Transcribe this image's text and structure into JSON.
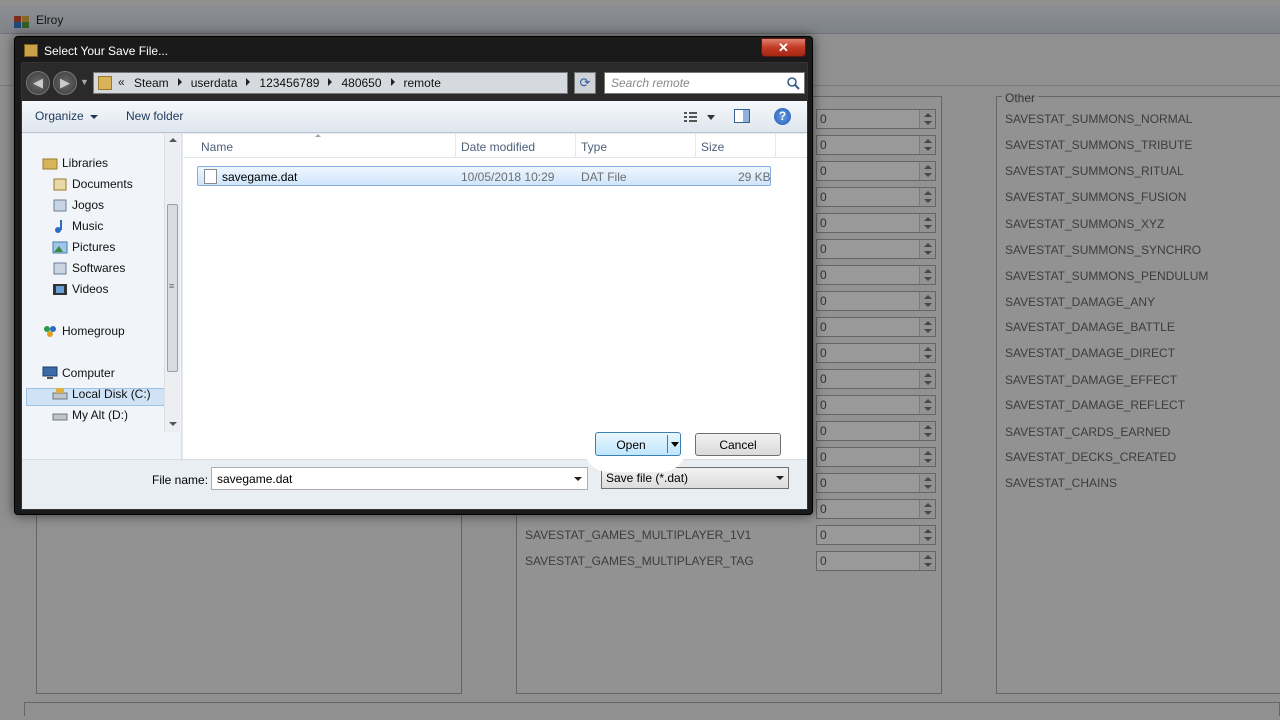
{
  "app": {
    "title": "Elroy",
    "panel_other_title": "Other",
    "other_stats": [
      "SAVESTAT_SUMMONS_NORMAL",
      "SAVESTAT_SUMMONS_TRIBUTE",
      "SAVESTAT_SUMMONS_RITUAL",
      "SAVESTAT_SUMMONS_FUSION",
      "SAVESTAT_SUMMONS_XYZ",
      "SAVESTAT_SUMMONS_SYNCHRO",
      "SAVESTAT_SUMMONS_PENDULUM",
      "SAVESTAT_DAMAGE_ANY",
      "SAVESTAT_DAMAGE_BATTLE",
      "SAVESTAT_DAMAGE_DIRECT",
      "SAVESTAT_DAMAGE_EFFECT",
      "SAVESTAT_DAMAGE_REFLECT",
      "SAVESTAT_CARDS_EARNED",
      "SAVESTAT_DECKS_CREATED",
      "SAVESTAT_CHAINS"
    ],
    "mid_stats": [
      "SAVESTAT_GAMES_MULTIPLAYER_1V1",
      "SAVESTAT_GAMES_MULTIPLAYER_TAG"
    ],
    "spinner_value": "0"
  },
  "dialog": {
    "title": "Select Your Save File...",
    "close_label": "✕",
    "breadcrumbs": [
      "Steam",
      "userdata",
      "123456789",
      "480650",
      "remote"
    ],
    "breadcrumb_overflow": "«",
    "search_placeholder": "Search remote",
    "toolbar": {
      "organize": "Organize",
      "new_folder": "New folder",
      "help": "?"
    },
    "nav": {
      "libraries": "Libraries",
      "library_items": [
        "Documents",
        "Jogos",
        "Music",
        "Pictures",
        "Softwares",
        "Videos"
      ],
      "homegroup": "Homegroup",
      "computer": "Computer",
      "drives": [
        "Local Disk (C:)",
        "My Alt (D:)"
      ],
      "scroll_grip": "≡"
    },
    "columns": [
      "Name",
      "Date modified",
      "Type",
      "Size"
    ],
    "files": [
      {
        "name": "savegame.dat",
        "date_modified": "10/05/2018 10:29",
        "type": "DAT File",
        "size": "29 KB"
      }
    ],
    "file_name_label": "File name:",
    "file_name_value": "savegame.dat",
    "file_type": "Save file (*.dat)",
    "open_label": "Open",
    "cancel_label": "Cancel"
  },
  "colors": {
    "accent": "#3c7fb1",
    "selection": "#cfe5fb",
    "close_red": "#c23a24"
  }
}
